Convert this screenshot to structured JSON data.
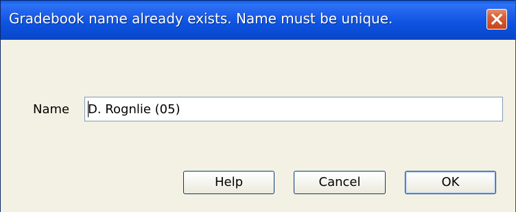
{
  "window": {
    "title": "Gradebook name already exists. Name must be unique.",
    "close_icon": "close-icon"
  },
  "form": {
    "name_label": "Name",
    "name_value": "D. Rognlie (05)"
  },
  "buttons": {
    "help_label": "Help",
    "cancel_label": "Cancel",
    "ok_label": "OK"
  },
  "colors": {
    "titlebar": "#0a4cd5",
    "window_background": "#f3f1e4",
    "close_button": "#d86138"
  }
}
